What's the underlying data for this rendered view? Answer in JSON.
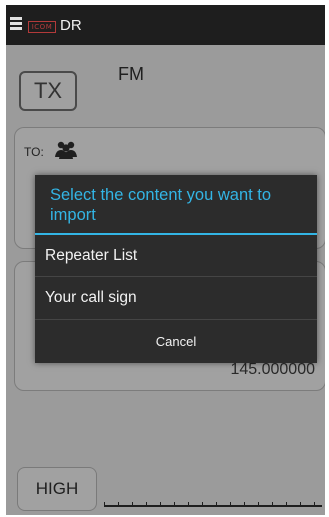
{
  "title_bar": {
    "logo": "ICOM",
    "mode": "DR"
  },
  "main": {
    "tx_label": "TX",
    "mode_label": "FM",
    "to_label": "TO:",
    "frequency": "145.000000",
    "power_label": "HIGH"
  },
  "dialog": {
    "title": "Select the content you want to import",
    "items": [
      {
        "label": "Repeater List"
      },
      {
        "label": "Your call sign"
      }
    ],
    "cancel_label": "Cancel"
  },
  "colors": {
    "accent": "#33b5e5",
    "dialog_bg": "#2c2c2c",
    "screen_bg": "#9b9b9b"
  },
  "icons": [
    "menu-icon",
    "group-icon"
  ]
}
